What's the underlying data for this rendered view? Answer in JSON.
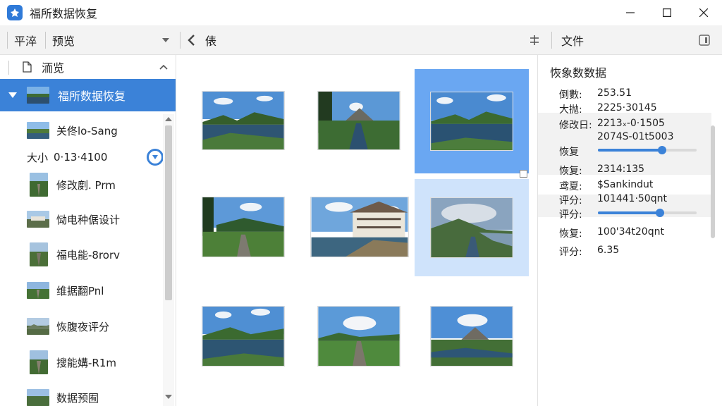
{
  "window": {
    "title": "福所数据恢复"
  },
  "toolbar": {
    "left_label": "平淬",
    "preview_label": "预览",
    "nav_label": "俵",
    "file_label": "文件"
  },
  "sidebar": {
    "header": "洏览",
    "selected": "福所数据恢复",
    "size_label": "大小",
    "size_value": "0·13·4100",
    "items": [
      {
        "label": "关佟lo-Sang"
      },
      {
        "label": "修改剫. Prm"
      },
      {
        "label": "恸电种倨设计"
      },
      {
        "label": "福电能-8rorv"
      },
      {
        "label": "维据翻Pnl"
      },
      {
        "label": "恢腹夜评分"
      },
      {
        "label": "搜能媾-R1m"
      },
      {
        "label": "数据预囿"
      }
    ]
  },
  "panel": {
    "title": "恢象数数据",
    "rows": [
      {
        "k": "倒數:",
        "v": "253.51"
      },
      {
        "k": "大抛:",
        "v": "2225·30145"
      },
      {
        "k": "修改日:",
        "v": "2213ₓ-0·1505"
      },
      {
        "k": "",
        "v": "2074S-01t5003"
      },
      {
        "k": "恢复",
        "v": ""
      },
      {
        "k": "恢复:",
        "v": "2314:135"
      },
      {
        "k": "鸢夏:",
        "v": "$Sankindut"
      },
      {
        "k": "评分:",
        "v": "101441·50qnt"
      },
      {
        "k": "评分:",
        "v": ""
      },
      {
        "k": "恢复:",
        "v": "100'34t20qnt"
      },
      {
        "k": "评分:",
        "v": "6.35"
      }
    ],
    "slider_values": [
      0.65,
      0.63
    ]
  },
  "photos": [
    "lake",
    "lake-trees",
    "lake-selected",
    "field-path",
    "villa",
    "valley-lake",
    "lake-small",
    "road-clouds",
    "mountain-meadow"
  ],
  "colors": {
    "accent": "#3b82d8",
    "selection": "#6aa7f2",
    "selection_light": "#cfe3fb"
  },
  "icons": [
    "app-logo-icon",
    "minimize-icon",
    "maximize-icon",
    "close-icon",
    "chevron-left-icon",
    "pin-icon",
    "panel-toggle-icon",
    "file-icon",
    "chevron-up-icon",
    "triangle-down-icon",
    "scroll-up-icon",
    "scroll-down-icon"
  ]
}
